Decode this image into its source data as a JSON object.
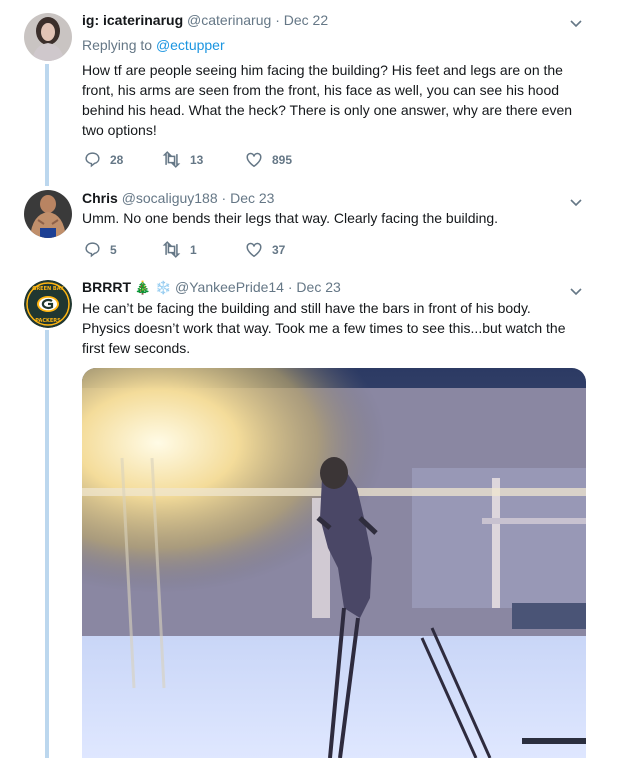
{
  "tweets": [
    {
      "name": "ig: icaterinarug",
      "handle": "@caterinarug",
      "dot": "·",
      "date": "Dec 22",
      "replying_prefix": "Replying to",
      "replying_to": "@ectupper",
      "text": "How tf are people seeing him facing the building? His feet and legs are on the front, his arms are seen from the front, his face as well, you can see his hood behind his head. What the heck? There is only one answer, why are there even two options!",
      "replies": "28",
      "retweets": "13",
      "likes": "895"
    },
    {
      "name": "Chris",
      "handle": "@socaliguy188",
      "dot": "·",
      "date": "Dec 23",
      "text": "Umm. No one bends their legs that way. Clearly facing the building.",
      "replies": "5",
      "retweets": "1",
      "likes": "37"
    },
    {
      "name": "BRRRT",
      "name_emoji_1": "🎄",
      "name_emoji_2": "❄️",
      "handle": "@YankeePride14",
      "dot": "·",
      "date": "Dec 23",
      "text": "He can’t be facing the building and still have the bars in front of his body. Physics doesn’t work that way. Took me a few times to see this...but watch the first few seconds."
    }
  ],
  "icons": [
    "reply-icon",
    "retweet-icon",
    "like-icon",
    "chevron-down-icon"
  ],
  "colors": {
    "link": "#1b95e0",
    "muted": "#657786",
    "thread": "#bcd7ee",
    "packers_green": "#203731",
    "packers_gold": "#ffb612"
  }
}
